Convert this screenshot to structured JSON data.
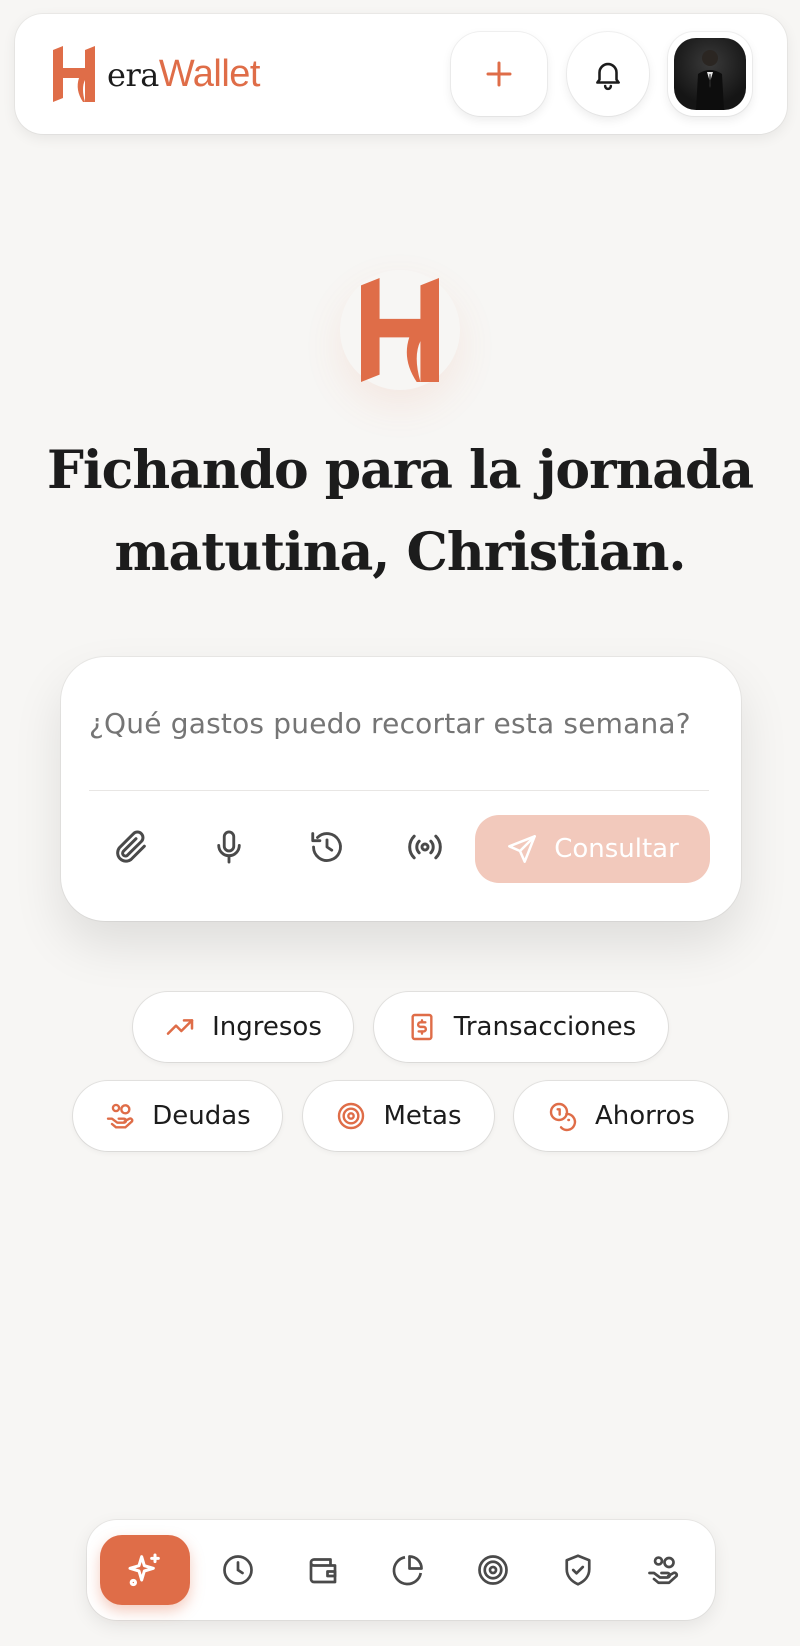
{
  "app": {
    "brand_prefix": "era",
    "brand_suffix": "Wallet",
    "accent_color": "#df6d48"
  },
  "header": {
    "add_icon": "plus-icon",
    "notifications_icon": "bell-icon",
    "avatar": "user-avatar"
  },
  "hero": {
    "title": "Fichando para la jornada matutina, Christian."
  },
  "query": {
    "placeholder": "¿Qué gastos puedo recortar esta semana?",
    "value": "",
    "tools": [
      "paperclip-icon",
      "microphone-icon",
      "history-icon",
      "broadcast-icon"
    ],
    "submit_label": "Consultar"
  },
  "chips": [
    {
      "label": "Ingresos",
      "icon": "trending-up-icon"
    },
    {
      "label": "Transacciones",
      "icon": "dollar-receipt-icon"
    },
    {
      "label": "Deudas",
      "icon": "hand-coins-icon"
    },
    {
      "label": "Metas",
      "icon": "target-icon"
    },
    {
      "label": "Ahorros",
      "icon": "coins-icon"
    }
  ],
  "bottom_nav": {
    "items": [
      "sparkles-icon",
      "clock-icon",
      "wallet-icon",
      "pie-chart-icon",
      "target-icon",
      "shield-check-icon",
      "hand-coins-icon"
    ],
    "active_index": 0
  }
}
